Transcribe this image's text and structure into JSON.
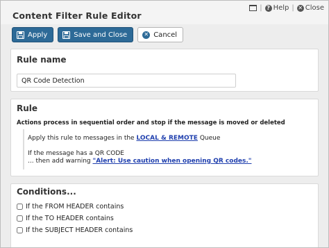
{
  "window": {
    "title": "Content Filter Rule Editor",
    "help_label": "Help",
    "close_label": "Close"
  },
  "toolbar": {
    "apply_label": "Apply",
    "save_close_label": "Save and Close",
    "cancel_label": "Cancel"
  },
  "rule_name": {
    "heading": "Rule name",
    "value": "QR Code Detection"
  },
  "rule": {
    "heading": "Rule",
    "description": "Actions process in sequential order and stop if the message is moved or deleted",
    "apply_prefix": "Apply this rule to messages in the",
    "queue_link": "LOCAL & REMOTE",
    "apply_suffix": "Queue",
    "condition_text": "If the message has a QR CODE",
    "action_prefix": "... then add warning",
    "warning_link": "\"Alert: Use caution when opening QR codes.\""
  },
  "conditions": {
    "heading": "Conditions...",
    "items": [
      {
        "label": "If the FROM HEADER contains",
        "checked": false
      },
      {
        "label": "If the TO HEADER contains",
        "checked": false
      },
      {
        "label": "If the SUBJECT HEADER contains",
        "checked": false
      }
    ]
  },
  "colors": {
    "primary": "#2d6a97",
    "link": "#1f3fae"
  },
  "icons": {
    "window": "window-icon",
    "help": "help-icon",
    "close": "close-icon",
    "save": "save-icon",
    "cancel": "cancel-icon"
  }
}
